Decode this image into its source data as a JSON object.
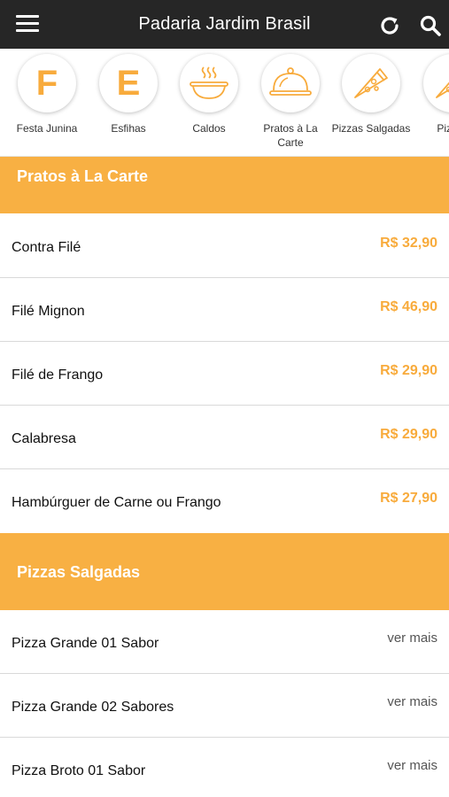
{
  "header": {
    "title": "Padaria Jardim Brasil",
    "menu_icon": "hamburger-menu-icon",
    "refresh_icon": "refresh-icon",
    "search_icon": "search-icon"
  },
  "categories": [
    {
      "label": "Festa Junina",
      "letter": "F",
      "icon": "letter-f-icon"
    },
    {
      "label": "Esfihas",
      "letter": "E",
      "icon": "letter-e-icon"
    },
    {
      "label": "Caldos",
      "letter": "",
      "icon": "soup-bowl-icon"
    },
    {
      "label": "Pratos à La Carte",
      "letter": "",
      "icon": "cloche-icon"
    },
    {
      "label": "Pizzas Salgadas",
      "letter": "",
      "icon": "pizza-slice-icon"
    },
    {
      "label": "Pizzas",
      "letter": "",
      "icon": "pizza-slice-icon"
    }
  ],
  "sections": [
    {
      "title": "Pratos à La Carte",
      "items": [
        {
          "name": "Contra Filé",
          "price": "R$ 32,90"
        },
        {
          "name": "Filé Mignon",
          "price": "R$ 46,90"
        },
        {
          "name": "Filé de Frango",
          "price": "R$ 29,90"
        },
        {
          "name": "Calabresa",
          "price": "R$ 29,90"
        },
        {
          "name": "Hambúrguer de Carne ou Frango",
          "price": "R$ 27,90"
        }
      ]
    },
    {
      "title": "Pizzas Salgadas",
      "items": [
        {
          "name": "Pizza Grande 01 Sabor",
          "more": "ver mais"
        },
        {
          "name": "Pizza Grande 02 Sabores",
          "more": "ver mais"
        },
        {
          "name": "Pizza Broto 01 Sabor",
          "more": "ver mais"
        }
      ]
    }
  ],
  "colors": {
    "accent": "#f8b043",
    "price": "#f8ab3c",
    "topbar": "#262626"
  }
}
